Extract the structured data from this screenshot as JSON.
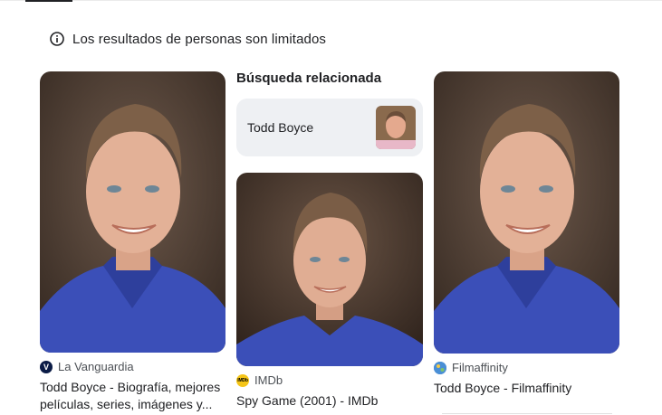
{
  "notice": {
    "icon": "info-icon",
    "text": "Los resultados de personas son limitados"
  },
  "related": {
    "heading": "Búsqueda relacionada",
    "chip_label": "Todd Boyce"
  },
  "results": [
    {
      "source": "La Vanguardia",
      "favicon_letter": "V",
      "title_line1": "Todd Boyce - Biografía, mejores",
      "title_line2": "películas, series, imágenes y..."
    },
    {
      "source": "IMDb",
      "favicon_letter": "IMDb",
      "title_line1": "Spy Game (2001) - IMDb"
    },
    {
      "source": "Filmaffinity",
      "title_line1": "Todd Boyce - Filmaffinity"
    }
  ],
  "colors": {
    "accent_text": "#202124",
    "muted_text": "#4d5156",
    "chip_bg": "#eef0f3",
    "shirt_blue": "#3b4fb8"
  }
}
